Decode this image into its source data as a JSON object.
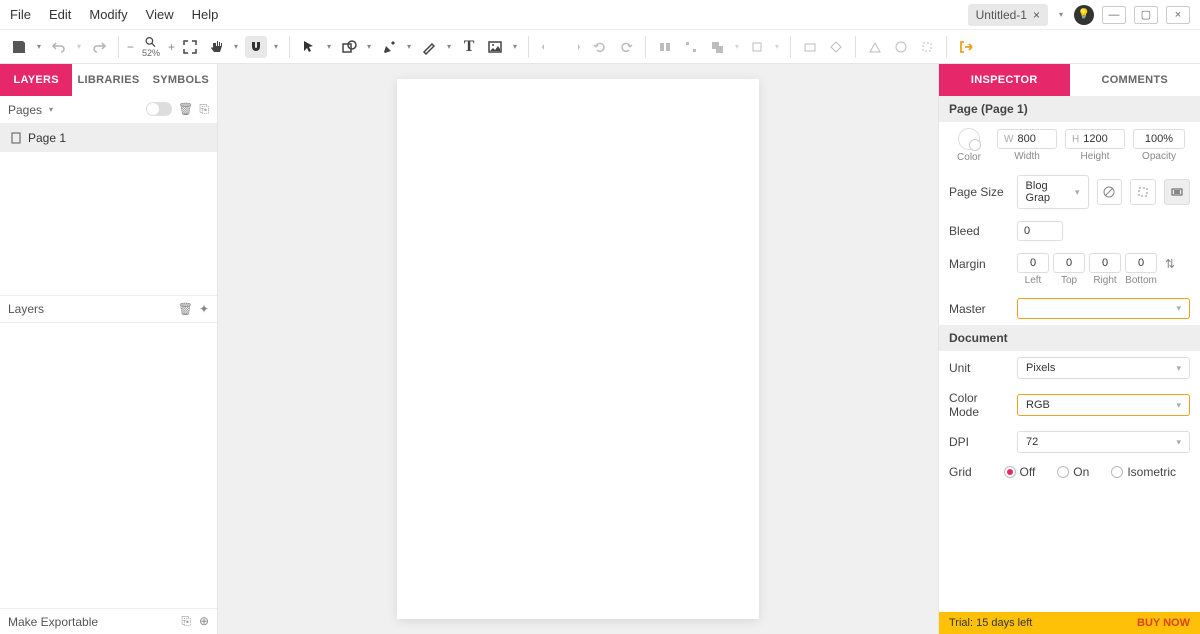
{
  "menu": {
    "file": "File",
    "edit": "Edit",
    "modify": "Modify",
    "view": "View",
    "help": "Help"
  },
  "doc_tab": {
    "title": "Untitled-1"
  },
  "zoom": "52%",
  "left_panel": {
    "tabs": {
      "layers": "LAYERS",
      "libraries": "LIBRARIES",
      "symbols": "SYMBOLS"
    },
    "pages_label": "Pages",
    "page1": "Page 1",
    "layers_label": "Layers",
    "export_label": "Make Exportable"
  },
  "right_panel": {
    "tabs": {
      "inspector": "INSPECTOR",
      "comments": "COMMENTS"
    },
    "page_header": "Page (Page 1)",
    "color_label": "Color",
    "width_val": "800",
    "width_label": "Width",
    "height_val": "1200",
    "height_label": "Height",
    "opacity_val": "100%",
    "opacity_label": "Opacity",
    "page_size_label": "Page Size",
    "page_size_val": "Blog Grap",
    "bleed_label": "Bleed",
    "bleed_val": "0",
    "margin_label": "Margin",
    "margins": {
      "left": "0",
      "top": "0",
      "right": "0",
      "bottom": "0"
    },
    "margin_labels": {
      "left": "Left",
      "top": "Top",
      "right": "Right",
      "bottom": "Bottom"
    },
    "master_label": "Master",
    "document_header": "Document",
    "unit_label": "Unit",
    "unit_val": "Pixels",
    "colormode_label": "Color Mode",
    "colormode_val": "RGB",
    "dpi_label": "DPI",
    "dpi_val": "72",
    "grid_label": "Grid",
    "grid_options": {
      "off": "Off",
      "on": "On",
      "iso": "Isometric"
    }
  },
  "trial": {
    "text": "Trial: 15 days left",
    "buy": "BUY NOW"
  }
}
